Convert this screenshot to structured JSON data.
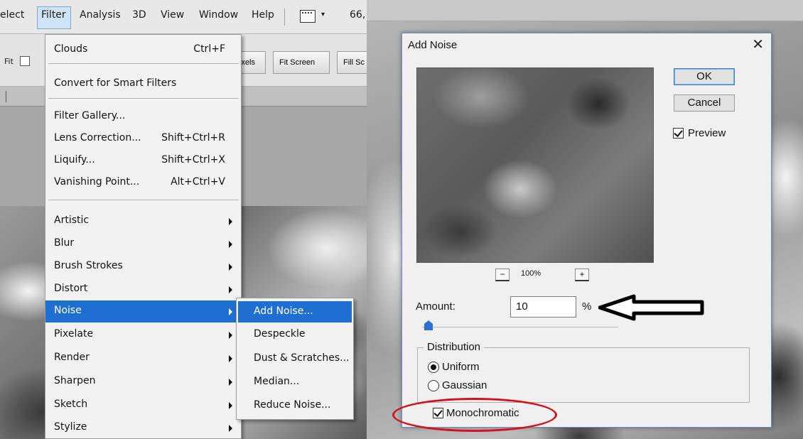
{
  "photoshop": {
    "menubar": {
      "items": [
        "elect",
        "Filter",
        "Analysis",
        "3D",
        "View",
        "Window",
        "Help"
      ],
      "zoom_partial": "66,",
      "workspace_caret": "▾"
    },
    "options_bar": {
      "fit_label": "Fit",
      "buttons": [
        "ixels",
        "Fit Screen",
        "Fill Sc"
      ]
    },
    "filter_menu": {
      "top_items": [
        {
          "label": "Clouds",
          "shortcut": "Ctrl+F"
        },
        {
          "label": "Convert for Smart Filters",
          "shortcut": ""
        },
        {
          "label": "Filter Gallery...",
          "shortcut": ""
        },
        {
          "label": "Lens Correction...",
          "shortcut": "Shift+Ctrl+R"
        },
        {
          "label": "Liquify...",
          "shortcut": "Shift+Ctrl+X"
        },
        {
          "label": "Vanishing Point...",
          "shortcut": "Alt+Ctrl+V"
        }
      ],
      "submenus": [
        "Artistic",
        "Blur",
        "Brush Strokes",
        "Distort",
        "Noise",
        "Pixelate",
        "Render",
        "Sharpen",
        "Sketch",
        "Stylize"
      ],
      "selected": "Noise"
    },
    "noise_submenu": {
      "items": [
        "Add Noise...",
        "Despeckle",
        "Dust & Scratches...",
        "Median...",
        "Reduce Noise..."
      ],
      "selected": "Add Noise..."
    }
  },
  "add_noise_dialog": {
    "title": "Add Noise",
    "close_glyph": "✕",
    "ok_label": "OK",
    "cancel_label": "Cancel",
    "preview_label": "Preview",
    "preview_checked": true,
    "zoom_out": "−",
    "zoom_in": "+",
    "zoom_level": "100%",
    "amount_label": "Amount:",
    "amount_value": "10",
    "amount_unit": "%",
    "amount_slider_fraction": 0.025,
    "distribution_title": "Distribution",
    "distribution_options": [
      {
        "label": "Uniform",
        "selected": true
      },
      {
        "label": "Gaussian",
        "selected": false
      }
    ],
    "monochromatic_label": "Monochromatic",
    "monochromatic_checked": true
  },
  "colors": {
    "menu_highlight": "#1e6fd0",
    "annotation_red": "#d4121d",
    "slider_thumb": "#2f6fd1"
  }
}
